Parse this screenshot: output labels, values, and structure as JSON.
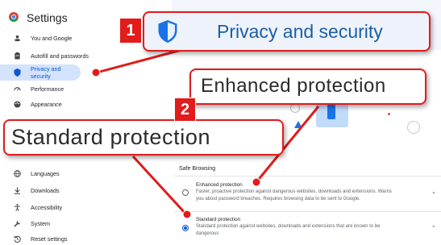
{
  "app": {
    "title": "Settings"
  },
  "sidebar": {
    "items": [
      {
        "label": "You and Google",
        "icon": "person-icon"
      },
      {
        "label": "Autofill and passwords",
        "icon": "clipboard-icon"
      },
      {
        "label": "Privacy and security",
        "icon": "shield-icon"
      },
      {
        "label": "Performance",
        "icon": "speedometer-icon"
      },
      {
        "label": "Appearance",
        "icon": "palette-icon"
      },
      {
        "label": "Languages",
        "icon": "globe-icon"
      },
      {
        "label": "Downloads",
        "icon": "download-icon"
      },
      {
        "label": "Accessibility",
        "icon": "accessibility-icon"
      },
      {
        "label": "System",
        "icon": "wrench-icon"
      },
      {
        "label": "Reset settings",
        "icon": "reset-icon"
      }
    ],
    "active_index": 2
  },
  "main": {
    "section_title": "Safe Browsing",
    "options": [
      {
        "title": "Enhanced protection",
        "desc_line1": "Faster, proactive protection against dangerous websites, downloads and extensions. Warns",
        "desc_line2": "you about password breaches. Requires browsing data to be sent to Google.",
        "checked": false
      },
      {
        "title": "Standard protection",
        "desc_line1": "Standard protection against websites, downloads and extensions that are known to be",
        "desc_line2": "dangerous",
        "checked": true
      }
    ]
  },
  "callouts": {
    "privacy": {
      "badge": "1",
      "text": "Privacy and security"
    },
    "enhanced": {
      "text": "Enhanced protection"
    },
    "standard": {
      "badge": "2",
      "text": "Standard protection"
    }
  },
  "colors": {
    "accent": "#0b57d0",
    "callout_red": "#e21b1b",
    "active_nav_bg": "#d3e3fd"
  }
}
